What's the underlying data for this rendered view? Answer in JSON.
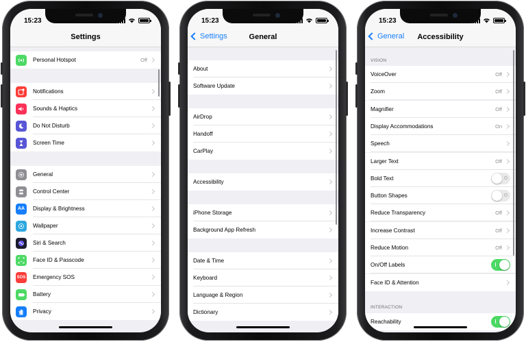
{
  "status": {
    "time": "15:23"
  },
  "settings": {
    "title": "Settings",
    "rows": [
      {
        "label": "Personal Hotspot",
        "value": "Off",
        "icon": "hotspot-icon",
        "color": "#4cd964"
      },
      {
        "label": "Notifications",
        "value": "",
        "icon": "notifications-icon",
        "color": "#fc3d39"
      },
      {
        "label": "Sounds & Haptics",
        "value": "",
        "icon": "speaker-icon",
        "color": "#fc3158"
      },
      {
        "label": "Do Not Disturb",
        "value": "",
        "icon": "moon-icon",
        "color": "#5856d6"
      },
      {
        "label": "Screen Time",
        "value": "",
        "icon": "hourglass-icon",
        "color": "#5856d6"
      },
      {
        "label": "General",
        "value": "",
        "icon": "gear-icon",
        "color": "#8e8e93"
      },
      {
        "label": "Control Center",
        "value": "",
        "icon": "toggles-icon",
        "color": "#8e8e93"
      },
      {
        "label": "Display & Brightness",
        "value": "",
        "icon": "text-size-icon",
        "color": "#157efb"
      },
      {
        "label": "Wallpaper",
        "value": "",
        "icon": "flower-icon",
        "color": "#2ea8df"
      },
      {
        "label": "Siri & Search",
        "value": "",
        "icon": "siri-icon",
        "color": "#1c1c2e"
      },
      {
        "label": "Face ID & Passcode",
        "value": "",
        "icon": "face-id-icon",
        "color": "#4cd964"
      },
      {
        "label": "Emergency SOS",
        "value": "",
        "icon": "sos-icon",
        "color": "#fc3d39"
      },
      {
        "label": "Battery",
        "value": "",
        "icon": "battery-icon",
        "color": "#4cd964"
      },
      {
        "label": "Privacy",
        "value": "",
        "icon": "hand-icon",
        "color": "#157efb"
      }
    ]
  },
  "general": {
    "title": "General",
    "back": "Settings",
    "rows": [
      {
        "label": "About"
      },
      {
        "label": "Software Update"
      },
      {
        "label": "AirDrop"
      },
      {
        "label": "Handoff"
      },
      {
        "label": "CarPlay"
      },
      {
        "label": "Accessibility"
      },
      {
        "label": "iPhone Storage"
      },
      {
        "label": "Background App Refresh"
      },
      {
        "label": "Date & Time"
      },
      {
        "label": "Keyboard"
      },
      {
        "label": "Language & Region"
      },
      {
        "label": "Dictionary"
      }
    ]
  },
  "accessibility": {
    "title": "Accessibility",
    "back": "General",
    "section_vision": "VISION",
    "section_interaction": "INTERACTION",
    "rows": [
      {
        "label": "VoiceOver",
        "value": "Off",
        "kind": "disclosure"
      },
      {
        "label": "Zoom",
        "value": "Off",
        "kind": "disclosure"
      },
      {
        "label": "Magnifier",
        "value": "Off",
        "kind": "disclosure"
      },
      {
        "label": "Display Accommodations",
        "value": "On",
        "kind": "disclosure"
      },
      {
        "label": "Speech",
        "value": "",
        "kind": "disclosure"
      },
      {
        "label": "Larger Text",
        "value": "Off",
        "kind": "disclosure"
      },
      {
        "label": "Bold Text",
        "value": "",
        "kind": "toggle",
        "on": false
      },
      {
        "label": "Button Shapes",
        "value": "",
        "kind": "toggle",
        "on": false
      },
      {
        "label": "Reduce Transparency",
        "value": "Off",
        "kind": "disclosure"
      },
      {
        "label": "Increase Contrast",
        "value": "Off",
        "kind": "disclosure"
      },
      {
        "label": "Reduce Motion",
        "value": "Off",
        "kind": "disclosure"
      },
      {
        "label": "On/Off Labels",
        "value": "",
        "kind": "toggle",
        "on": true
      },
      {
        "label": "Face ID & Attention",
        "value": "",
        "kind": "disclosure"
      },
      {
        "label": "Reachability",
        "value": "",
        "kind": "toggle",
        "on": true
      }
    ]
  },
  "colors": {
    "accent": "#157efb",
    "toggle_on": "#4cd964",
    "grouped_bg": "#efeff4"
  }
}
